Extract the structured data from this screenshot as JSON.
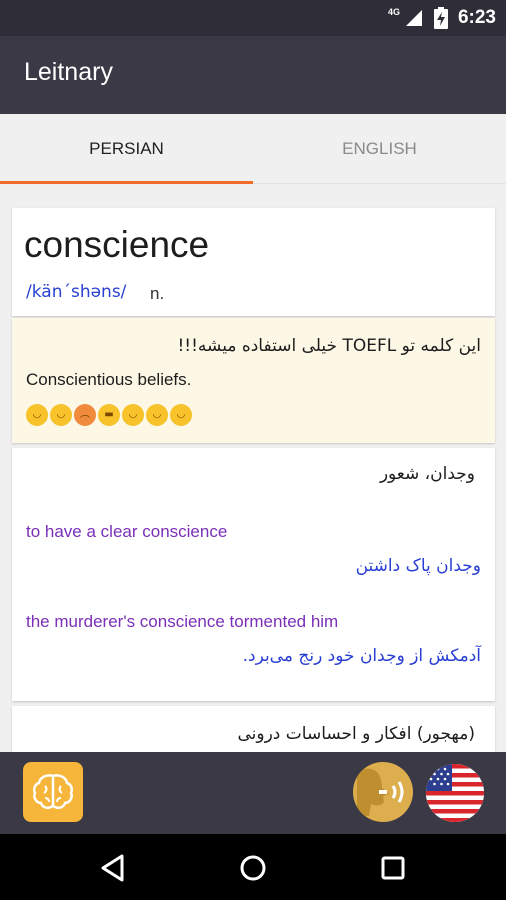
{
  "status_bar": {
    "time": "6:23",
    "network": "4G",
    "icons": [
      "signal-icon",
      "battery-charging-icon"
    ]
  },
  "app_bar": {
    "title": "Leitnary"
  },
  "tabs": [
    {
      "label": "PERSIAN",
      "selected": true
    },
    {
      "label": "ENGLISH",
      "selected": false
    }
  ],
  "colors": {
    "app_bar_bg": "#3a3945",
    "tab_indicator": "#f26b2b",
    "example_en": "#7a2fb8",
    "example_fa": "#2a40d4",
    "note_bg": "#fdf7e6",
    "brain_button_bg": "#f6b63c"
  },
  "word_card": {
    "word": "conscience",
    "pronunciation": "/kän´shəns/",
    "part_of_speech": "n."
  },
  "note_card": {
    "persian_note": "این کلمه تو TOEFL خیلی استفاده میشه!!!",
    "english_note": "Conscientious beliefs.",
    "emojis": [
      "smiling-face-icon",
      "smiling-face-icon",
      "angry-face-icon",
      "grinning-face-icon",
      "smiling-face-icon",
      "smiling-face-icon",
      "smiling-face-icon"
    ]
  },
  "meaning_card": {
    "meaning": "وجدان، شعور",
    "examples": [
      {
        "en": "to have a clear conscience",
        "fa": "وجدان پاک داشتن"
      },
      {
        "en": "the murderer's conscience tormented him",
        "fa": "آدمکش از وجدان خود رنج می‌برد."
      }
    ]
  },
  "meaning_card_2": {
    "meaning": "(مهجور) افکار و احساسات درونی"
  },
  "bottom_bar": {
    "icons": [
      "brain-icon",
      "speaker-icon",
      "us-flag-icon"
    ]
  },
  "nav_bar": {
    "icons": [
      "back-icon",
      "home-icon",
      "recent-apps-icon"
    ]
  }
}
